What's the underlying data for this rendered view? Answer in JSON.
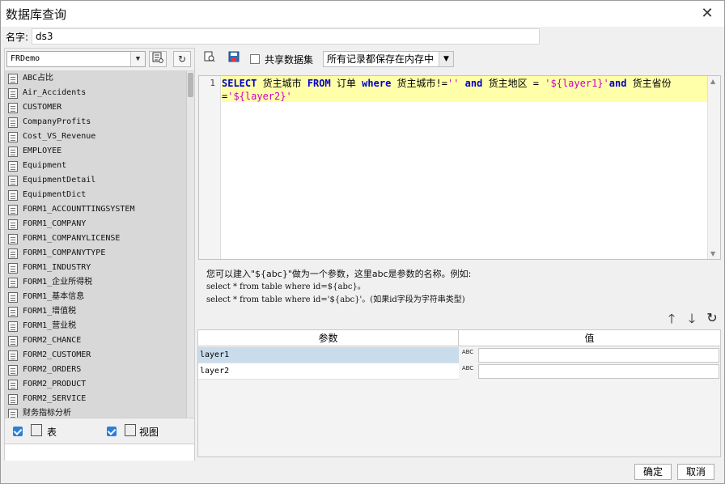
{
  "window": {
    "title": "数据库查询"
  },
  "name_field": {
    "label": "名字:",
    "value": "ds3"
  },
  "left": {
    "connection": "FRDemo",
    "tables": [
      "ABC占比",
      "Air_Accidents",
      "CUSTOMER",
      "CompanyProfits",
      "Cost_VS_Revenue",
      "EMPLOYEE",
      "Equipment",
      "EquipmentDetail",
      "EquipmentDict",
      "FORM1_ACCOUNTTINGSYSTEM",
      "FORM1_COMPANY",
      "FORM1_COMPANYLICENSE",
      "FORM1_COMPANYTYPE",
      "FORM1_INDUSTRY",
      "FORM1_企业所得税",
      "FORM1_基本信息",
      "FORM1_增值税",
      "FORM1_营业税",
      "FORM2_CHANCE",
      "FORM2_CUSTOMER",
      "FORM2_ORDERS",
      "FORM2_PRODUCT",
      "FORM2_SERVICE",
      "财务指标分析"
    ],
    "show_tables_label": "表",
    "show_views_label": "视图"
  },
  "toolbar": {
    "share_label": "共享数据集",
    "memory_option": "所有记录都保存在内存中"
  },
  "editor": {
    "line_number": "1",
    "tokens": [
      {
        "t": "SELECT",
        "c": "kw"
      },
      {
        "t": "  货主城市 ",
        "c": ""
      },
      {
        "t": "FROM",
        "c": "kw"
      },
      {
        "t": " 订单 ",
        "c": ""
      },
      {
        "t": "where",
        "c": "kw"
      },
      {
        "t": " 货主城市!=",
        "c": ""
      },
      {
        "t": "''",
        "c": "str"
      },
      {
        "t": " ",
        "c": ""
      },
      {
        "t": "and",
        "c": "kw"
      },
      {
        "t": " 货主地区 = ",
        "c": ""
      },
      {
        "t": "'${layer1}'",
        "c": "str"
      },
      {
        "t": "and",
        "c": "kw"
      },
      {
        "t": " 货主省份=",
        "c": ""
      },
      {
        "t": "'${layer2}'",
        "c": "str"
      }
    ]
  },
  "hint": {
    "line1": "您可以建入\"${abc}\"做为一个参数，这里abc是参数的名称。例如:",
    "line2": "select * from table where id=${abc}。",
    "line3": "select * from table where id='${abc}'。(如果id字段为字符串类型)"
  },
  "params": {
    "col_name": "参数",
    "col_value": "值",
    "rows": [
      {
        "name": "layer1",
        "type": "ABC",
        "value": ""
      },
      {
        "name": "layer2",
        "type": "ABC",
        "value": ""
      }
    ]
  },
  "footer": {
    "ok": "确定",
    "cancel": "取消"
  }
}
